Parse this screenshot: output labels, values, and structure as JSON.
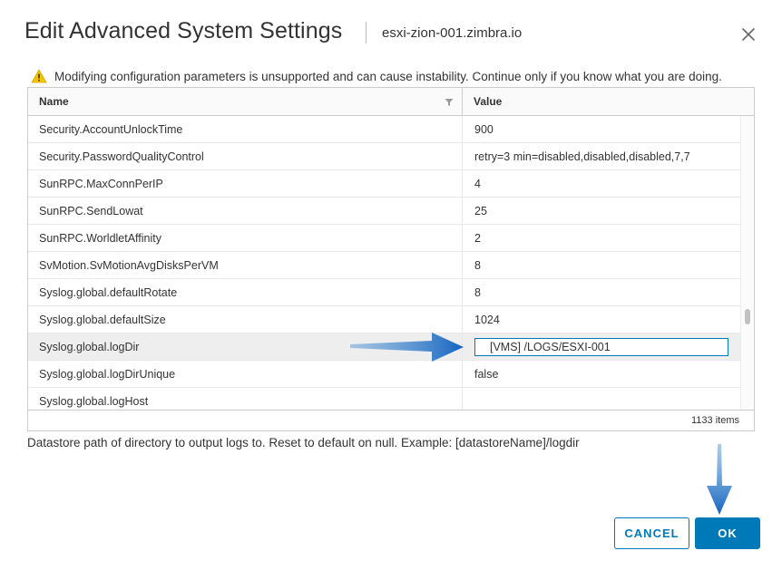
{
  "dialog": {
    "title": "Edit Advanced System Settings",
    "host": "esxi-zion-001.zimbra.io",
    "close_icon": "close-icon"
  },
  "warning": {
    "icon": "warning-triangle-icon",
    "text": "Modifying configuration parameters is unsupported and can cause instability. Continue only if you know what you are doing."
  },
  "grid": {
    "columns": [
      "Name",
      "Value"
    ],
    "rows": [
      {
        "name": "Security.AccountUnlockTime",
        "value": "900"
      },
      {
        "name": "Security.PasswordQualityControl",
        "value": "retry=3 min=disabled,disabled,disabled,7,7"
      },
      {
        "name": "SunRPC.MaxConnPerIP",
        "value": "4"
      },
      {
        "name": "SunRPC.SendLowat",
        "value": "25"
      },
      {
        "name": "SunRPC.WorldletAffinity",
        "value": "2"
      },
      {
        "name": "SvMotion.SvMotionAvgDisksPerVM",
        "value": "8"
      },
      {
        "name": "Syslog.global.defaultRotate",
        "value": "8"
      },
      {
        "name": "Syslog.global.defaultSize",
        "value": "1024"
      },
      {
        "name": "Syslog.global.logDir",
        "value": "[VMS] /LOGS/ESXI-001",
        "editing": true
      },
      {
        "name": "Syslog.global.logDirUnique",
        "value": "false"
      },
      {
        "name": "Syslog.global.logHost",
        "value": ""
      }
    ],
    "item_count": "1133 items"
  },
  "description": "Datastore path of directory to output logs to. Reset to default on null. Example: [datastoreName]/logdir",
  "buttons": {
    "cancel": "CANCEL",
    "ok": "OK"
  },
  "colors": {
    "accent": "#0079b8",
    "annotation_arrow": "#1565c0",
    "warning": "#f5c300"
  }
}
